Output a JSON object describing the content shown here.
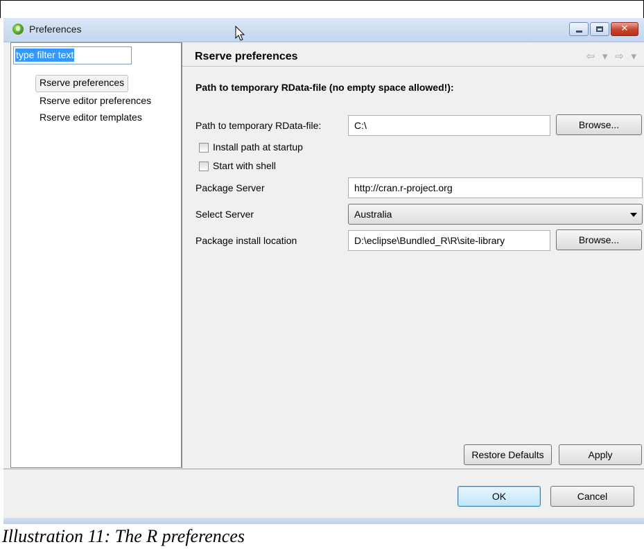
{
  "window": {
    "title": "Preferences",
    "minimize_icon": "minimize-icon",
    "maximize_icon": "maximize-icon",
    "close_icon": "close-icon",
    "close_glyph": "✕"
  },
  "sidebar": {
    "filter": {
      "value": "type filter text"
    },
    "items": [
      {
        "label": "Rserve preferences",
        "selected": true
      },
      {
        "label": "Rserve editor preferences",
        "selected": false
      },
      {
        "label": "Rserve editor templates",
        "selected": false
      }
    ]
  },
  "page": {
    "title": "Rserve preferences",
    "nav_glyphs": "⇦ ▾ ⇨ ▾",
    "section_title": "Path to temporary RData-file (no empty space allowed!):",
    "rdata_path": {
      "label": "Path to temporary RData-file:",
      "value": "C:\\",
      "browse_label": "Browse..."
    },
    "install_path_checkbox": {
      "label": "Install path at startup",
      "checked": false
    },
    "start_shell_checkbox": {
      "label": "Start with shell",
      "checked": false
    },
    "package_server": {
      "label": "Package Server",
      "value": "http://cran.r-project.org"
    },
    "select_server": {
      "label": "Select Server",
      "selected": "Australia"
    },
    "install_location": {
      "label": "Package install location",
      "value": "D:\\eclipse\\Bundled_R\\R\\site-library",
      "browse_label": "Browse..."
    },
    "restore_defaults_label": "Restore Defaults",
    "apply_label": "Apply"
  },
  "footer": {
    "ok_label": "OK",
    "cancel_label": "Cancel"
  },
  "caption": "Illustration 11: The R preferences",
  "colors": {
    "selection": "#3399ff",
    "titlebar": "#c4d6ee",
    "close_button": "#c8432c"
  }
}
